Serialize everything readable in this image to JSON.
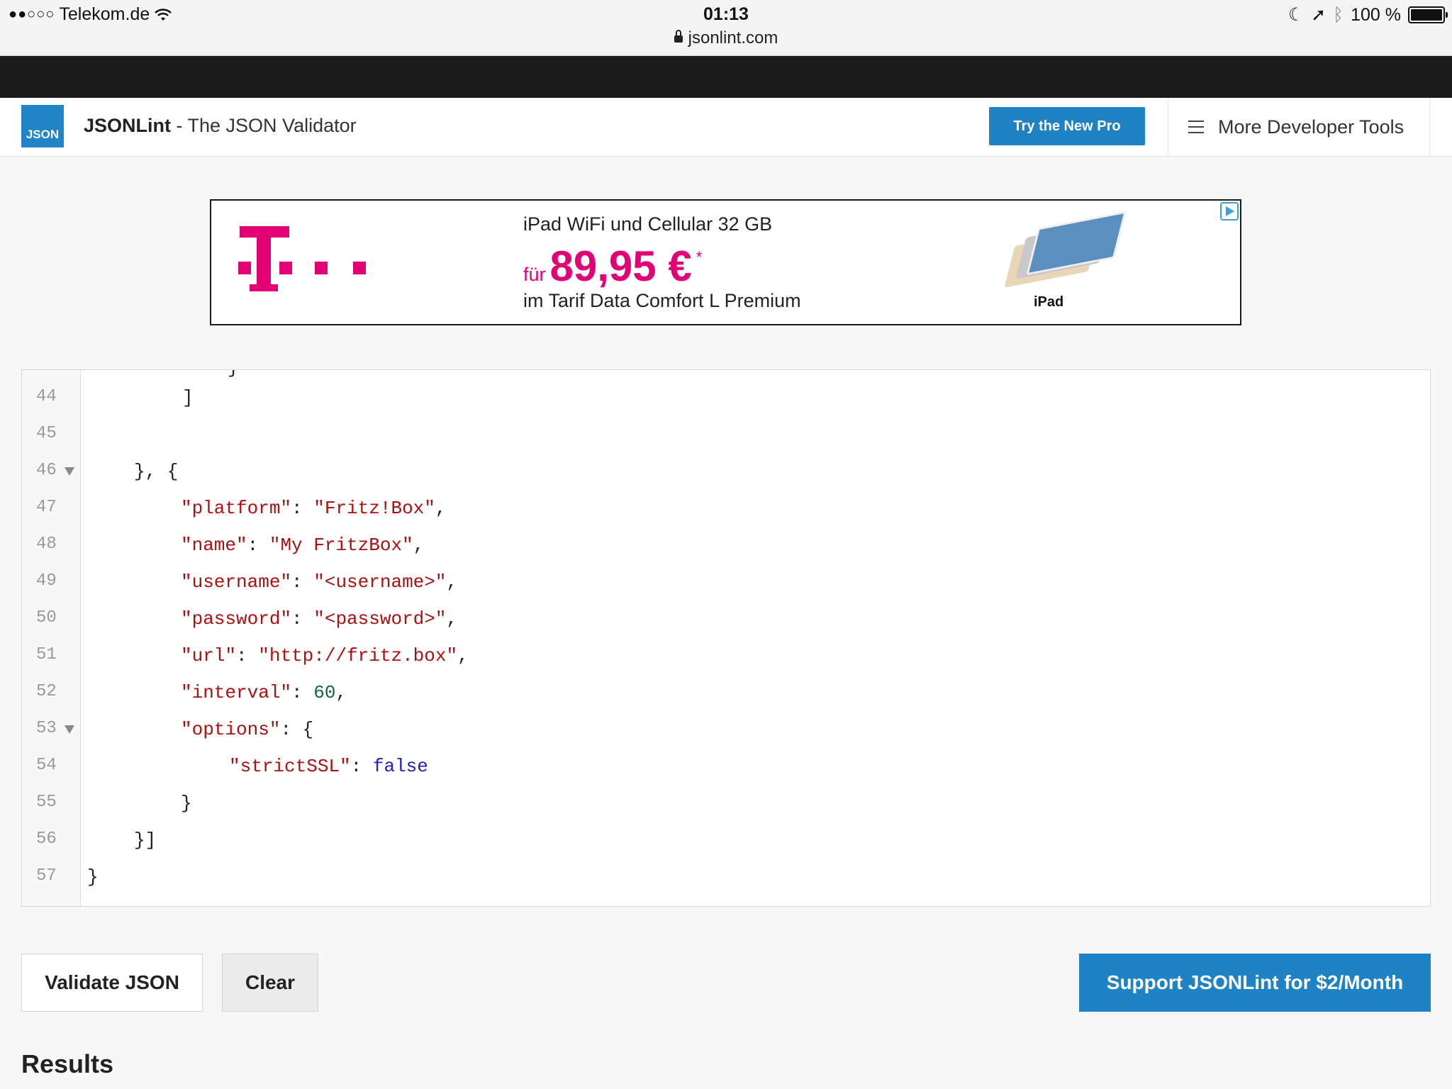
{
  "status_bar": {
    "carrier": "Telekom.de",
    "time": "01:13",
    "url": "jsonlint.com",
    "battery": "100 %"
  },
  "header": {
    "logo_text": "JSON",
    "brand_name": "JSONLint",
    "brand_tagline": " - The JSON Validator",
    "pro_button": "Try the New Pro",
    "more_tools": "More Developer Tools"
  },
  "ad": {
    "line1": "iPad WiFi und Cellular 32 GB",
    "fur": "für",
    "price": "89,95 €",
    "price_star": "*",
    "line3": "im Tarif Data Comfort L Premium",
    "product_label": "iPad",
    "brand_color": "#e20074"
  },
  "editor": {
    "lines": [
      {
        "num": "44",
        "fold": false
      },
      {
        "num": "45",
        "fold": false
      },
      {
        "num": "46",
        "fold": true
      },
      {
        "num": "47",
        "fold": false
      },
      {
        "num": "48",
        "fold": false
      },
      {
        "num": "49",
        "fold": false
      },
      {
        "num": "50",
        "fold": false
      },
      {
        "num": "51",
        "fold": false
      },
      {
        "num": "52",
        "fold": false
      },
      {
        "num": "53",
        "fold": true
      },
      {
        "num": "54",
        "fold": false
      },
      {
        "num": "55",
        "fold": false
      },
      {
        "num": "56",
        "fold": false
      },
      {
        "num": "57",
        "fold": false
      }
    ],
    "code": {
      "l44": "]",
      "l46": "}, {",
      "l47_key": "\"platform\"",
      "l47_val": "\"Fritz!Box\"",
      "l48_key": "\"name\"",
      "l48_val": "\"My FritzBox\"",
      "l49_key": "\"username\"",
      "l49_val": "\"<username>\"",
      "l50_key": "\"password\"",
      "l50_val": "\"<password>\"",
      "l51_key": "\"url\"",
      "l51_val": "\"http://fritz.box\"",
      "l52_key": "\"interval\"",
      "l52_val": "60",
      "l53_key": "\"options\"",
      "l54_key": "\"strictSSL\"",
      "l54_val": "false",
      "l55": "}",
      "l56": "}]",
      "l57": "}"
    }
  },
  "actions": {
    "validate": "Validate JSON",
    "clear": "Clear",
    "support": "Support JSONLint for $2/Month"
  },
  "results_heading": "Results",
  "colors": {
    "accent": "#1f82c4",
    "string": "#aa1111",
    "number": "#116644",
    "atom": "#2222aa"
  }
}
